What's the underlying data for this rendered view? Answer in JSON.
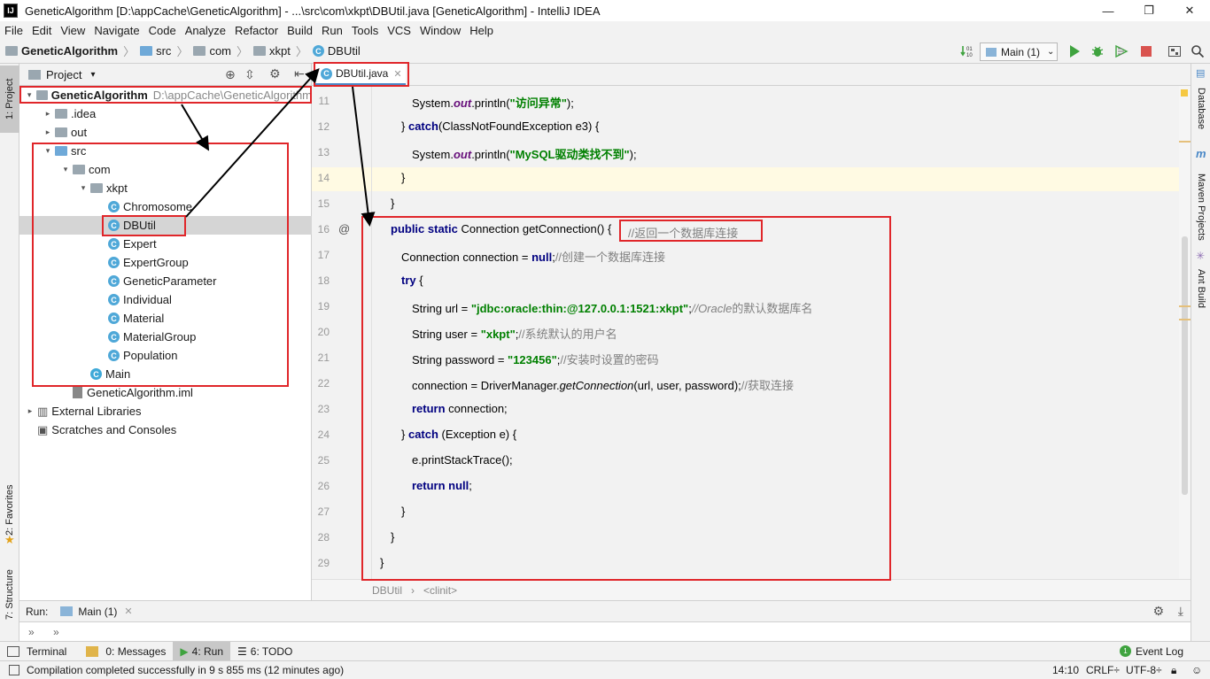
{
  "window": {
    "title": "GeneticAlgorithm [D:\\appCache\\GeneticAlgorithm] - ...\\src\\com\\xkpt\\DBUtil.java [GeneticAlgorithm] - IntelliJ IDEA",
    "minimize": "—",
    "maximize": "❐",
    "close": "✕"
  },
  "menu": [
    "File",
    "Edit",
    "View",
    "Navigate",
    "Code",
    "Analyze",
    "Refactor",
    "Build",
    "Run",
    "Tools",
    "VCS",
    "Window",
    "Help"
  ],
  "nav": {
    "crumbs": [
      "GeneticAlgorithm",
      "src",
      "com",
      "xkpt",
      "DBUtil"
    ],
    "run_config": "Main (1)"
  },
  "left_strip": {
    "project": "1: Project",
    "favorites": "2: Favorites",
    "structure": "7: Structure"
  },
  "right_strip": {
    "database": "Database",
    "maven": "Maven Projects",
    "ant": "Ant Build"
  },
  "project_panel": {
    "header": "Project",
    "tree": [
      {
        "label": "GeneticAlgorithm",
        "path": "D:\\appCache\\GeneticAlgorithm",
        "indent": 0,
        "arrow": "⌄",
        "kind": "module"
      },
      {
        "label": ".idea",
        "indent": 1,
        "arrow": "›",
        "kind": "folder"
      },
      {
        "label": "out",
        "indent": 1,
        "arrow": "›",
        "kind": "folder"
      },
      {
        "label": "src",
        "indent": 1,
        "arrow": "⌄",
        "kind": "srcfolder"
      },
      {
        "label": "com",
        "indent": 2,
        "arrow": "⌄",
        "kind": "package"
      },
      {
        "label": "xkpt",
        "indent": 3,
        "arrow": "⌄",
        "kind": "package"
      },
      {
        "label": "Chromosome",
        "indent": 4,
        "kind": "class"
      },
      {
        "label": "DBUtil",
        "indent": 4,
        "kind": "class"
      },
      {
        "label": "Expert",
        "indent": 4,
        "kind": "class"
      },
      {
        "label": "ExpertGroup",
        "indent": 4,
        "kind": "class"
      },
      {
        "label": "GeneticParameter",
        "indent": 4,
        "kind": "class"
      },
      {
        "label": "Individual",
        "indent": 4,
        "kind": "class"
      },
      {
        "label": "Material",
        "indent": 4,
        "kind": "class"
      },
      {
        "label": "MaterialGroup",
        "indent": 4,
        "kind": "class"
      },
      {
        "label": "Population",
        "indent": 4,
        "kind": "class"
      },
      {
        "label": "Main",
        "indent": 3,
        "kind": "main"
      },
      {
        "label": "GeneticAlgorithm.iml",
        "indent": 2,
        "kind": "iml"
      },
      {
        "label": "External Libraries",
        "indent": 0,
        "arrow": "›",
        "kind": "libs"
      },
      {
        "label": "Scratches and Consoles",
        "indent": 0,
        "kind": "scratch"
      }
    ]
  },
  "editor": {
    "tab_label": "DBUtil.java",
    "lines": [
      {
        "n": "11",
        "indent": 2,
        "html": "System.<span class=\"fld\">out</span>.println(<span class=\"str\">\"访问异常\"</span>);"
      },
      {
        "n": "12",
        "indent": 1,
        "html": "} <span class=\"kw\">catch</span>(ClassNotFoundException e3) {"
      },
      {
        "n": "13",
        "indent": 2,
        "html": "System.<span class=\"fld\">out</span>.println(<span class=\"str\">\"MySQL驱动类找不到\"</span>);"
      },
      {
        "n": "14",
        "indent": 1,
        "html": "}"
      },
      {
        "n": "15",
        "indent": 0,
        "html": "}"
      },
      {
        "n": "16",
        "indent": 0,
        "html": "<span class=\"kw\">public static</span> Connection getConnection() {"
      },
      {
        "n": "17",
        "indent": 1,
        "html": "Connection connection = <span class=\"kw\">null</span>;<span class=\"cmt-cn\">//创建一个数据库连接</span>"
      },
      {
        "n": "18",
        "indent": 1,
        "html": "<span class=\"kw\">try</span> {"
      },
      {
        "n": "19",
        "indent": 2,
        "html": "String url = <span class=\"str\">\"jdbc:oracle:thin:@127.0.0.1:1521:xkpt\"</span>;<span class=\"cmt\">//Oracle</span><span class=\"cmt-cn\">的默认数据库名</span>"
      },
      {
        "n": "20",
        "indent": 2,
        "html": "String user = <span class=\"str\">\"xkpt\"</span>;<span class=\"cmt-cn\">//系统默认的用户名</span>"
      },
      {
        "n": "21",
        "indent": 2,
        "html": "String password = <span class=\"str\">\"123456\"</span>;<span class=\"cmt-cn\">//安装时设置的密码</span>"
      },
      {
        "n": "22",
        "indent": 2,
        "html": "connection = DriverManager.<span class=\"mth-i\">getConnection</span>(url, user, password);<span class=\"cmt-cn\">//获取连接</span>"
      },
      {
        "n": "23",
        "indent": 2,
        "html": "<span class=\"kw\">return</span> connection;"
      },
      {
        "n": "24",
        "indent": 1,
        "html": "} <span class=\"kw\">catch</span> (Exception e) {"
      },
      {
        "n": "25",
        "indent": 2,
        "html": "e.printStackTrace();"
      },
      {
        "n": "26",
        "indent": 2,
        "html": "<span class=\"kw\">return null</span>;"
      },
      {
        "n": "27",
        "indent": 1,
        "html": "}"
      },
      {
        "n": "28",
        "indent": 0,
        "html": "}"
      },
      {
        "n": "29",
        "indent": -1,
        "html": "}"
      }
    ],
    "method_comment": "//返回一个数据库连接",
    "breadcrumb": [
      "DBUtil",
      "<clinit>"
    ]
  },
  "run_panel": {
    "label": "Run:",
    "tab": "Main (1)"
  },
  "bottom_tabs": [
    "Terminal",
    "0: Messages",
    "4: Run",
    "6: TODO"
  ],
  "event_log": "Event Log",
  "status": {
    "message": "Compilation completed successfully in 9 s 855 ms (12 minutes ago)",
    "position": "14:10",
    "line_sep": "CRLF÷",
    "encoding": "UTF-8÷"
  },
  "colors": {
    "accent": "#4a88c7",
    "annotation": "#e0262a",
    "run_green": "#3fa33f",
    "stop_red": "#d9534f"
  }
}
